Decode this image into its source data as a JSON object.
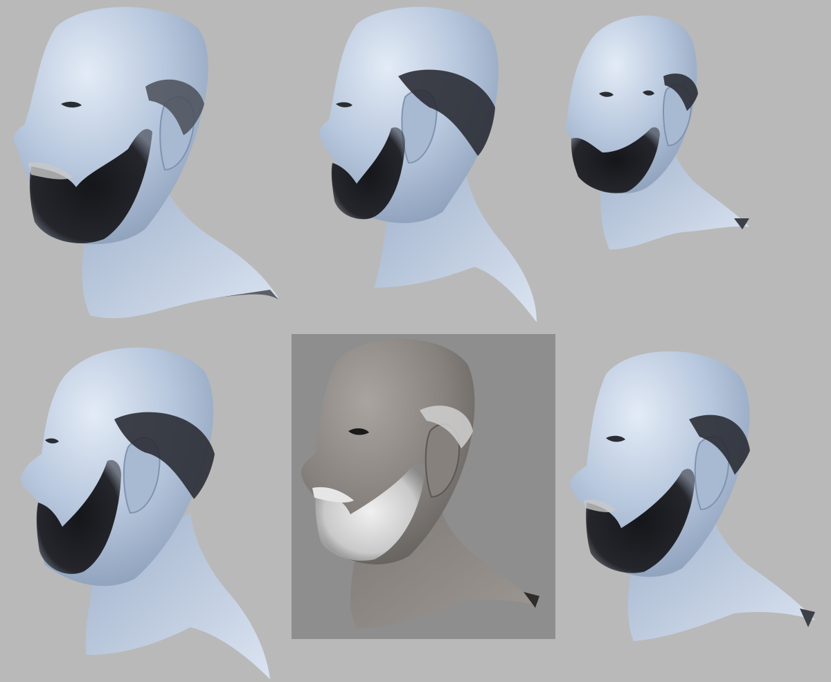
{
  "scene": {
    "background_color": "#b9b9b9",
    "panel_color": "#8e8e8e",
    "skin_colors": {
      "clay_blue": "#aebfd6",
      "clay_blue_shadow": "#8296b3",
      "clay_blue_highlight": "#dfe8f4",
      "clay_grey": "#8b8683",
      "clay_grey_shadow": "#5f5b58",
      "clay_grey_highlight": "#a9a4a0"
    },
    "hair_colors": {
      "dark_beard": "#1c1d22",
      "grey_beard": "#d9d9d9"
    },
    "renders": [
      {
        "name": "render-top-left",
        "shading": "clay_blue",
        "beard": "dark",
        "facing": "left"
      },
      {
        "name": "render-top-center",
        "shading": "clay_blue",
        "beard": "dark",
        "facing": "left"
      },
      {
        "name": "render-top-right",
        "shading": "clay_blue",
        "beard": "dark",
        "facing": "three-quarter-left"
      },
      {
        "name": "render-bottom-left",
        "shading": "clay_blue",
        "beard": "dark",
        "facing": "left"
      },
      {
        "name": "render-bottom-center",
        "shading": "clay_grey",
        "beard": "grey",
        "facing": "left"
      },
      {
        "name": "render-bottom-right",
        "shading": "clay_blue",
        "beard": "dark",
        "facing": "left"
      }
    ]
  }
}
